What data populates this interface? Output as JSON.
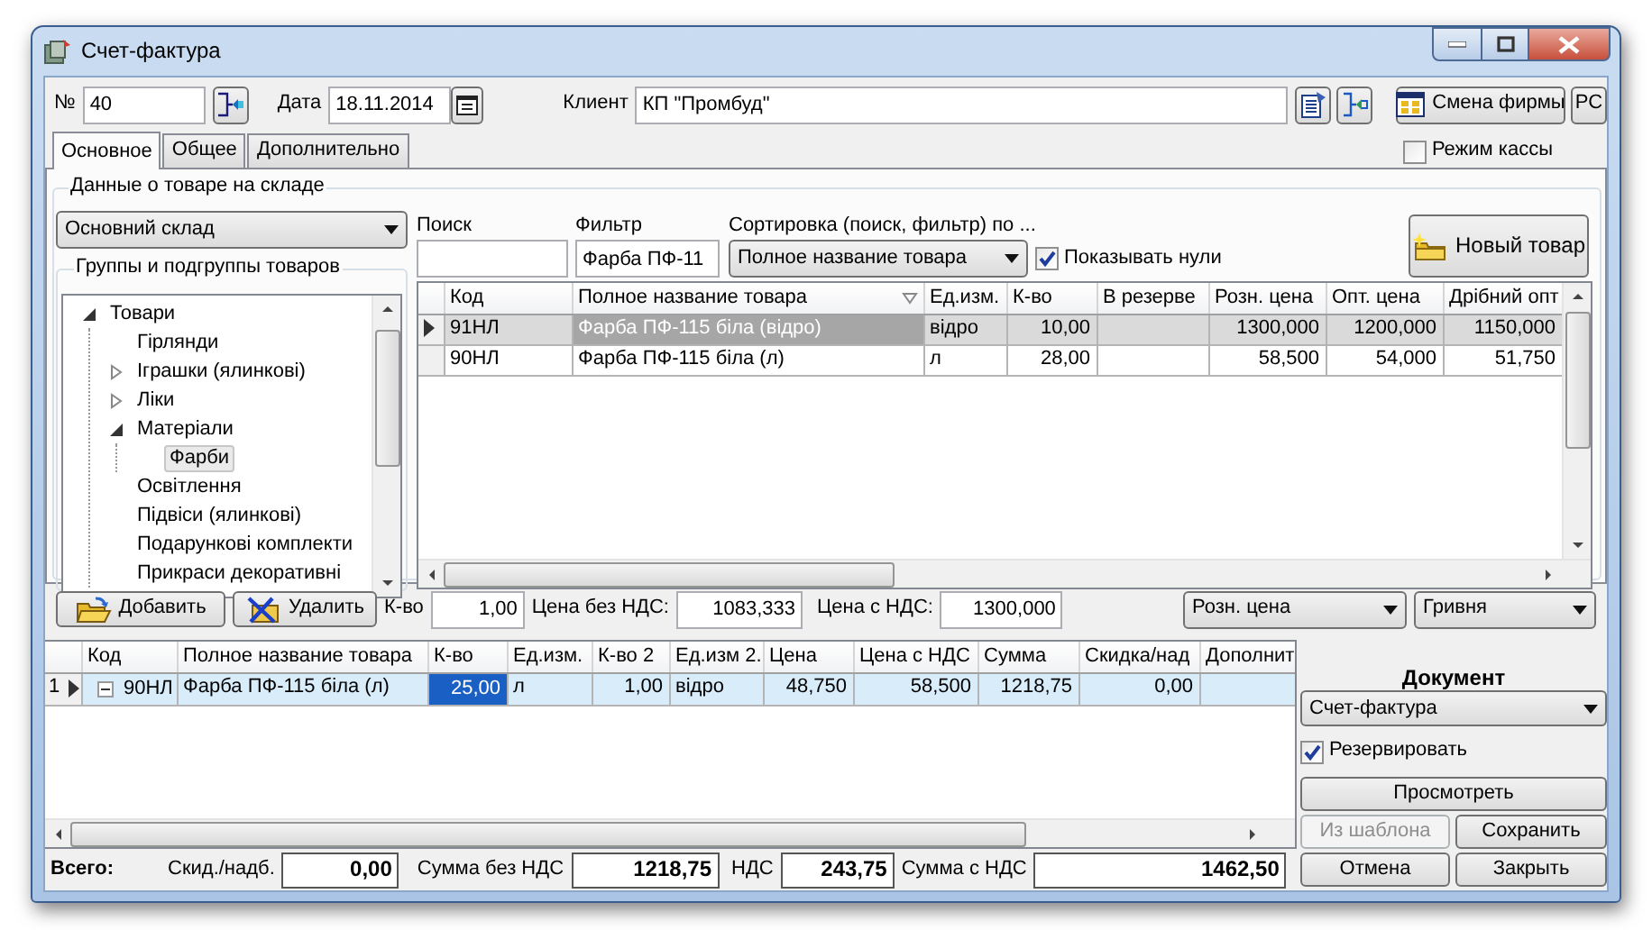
{
  "window": {
    "title": "Счет-фактура"
  },
  "header": {
    "number_label": "№",
    "number": "40",
    "date_label": "Дата",
    "date": "18.11.2014",
    "client_label": "Клиент",
    "client": "КП \"Промбуд\"",
    "firm_button": "Смена фирмы",
    "rs_button": "РС"
  },
  "tabs": [
    {
      "label": "Основное",
      "selected": true
    },
    {
      "label": "Общее",
      "selected": false
    },
    {
      "label": "Дополнительно",
      "selected": false
    }
  ],
  "cash_mode": {
    "label": "Режим кассы",
    "checked": false
  },
  "stock": {
    "legend": "Данные о товаре на складе",
    "warehouse": "Основний склад",
    "groups_legend": "Группы и подгруппы товаров",
    "search_label": "Поиск",
    "filter_label": "Фильтр",
    "filter": "Фарба ПФ-11",
    "sort_label": "Сортировка (поиск, фильтр) по ...",
    "sort": "Полное название товара",
    "show_zeros": {
      "label": "Показывать нули",
      "checked": true
    },
    "new_button": "Новый товар"
  },
  "tree": [
    {
      "label": "Товари",
      "expanded": true,
      "selected": false,
      "children": [
        {
          "label": "Гірлянди",
          "selected": false
        },
        {
          "label": "Іграшки (ялинкові)",
          "expanded": false,
          "selected": false
        },
        {
          "label": "Ліки",
          "expanded": false,
          "selected": false
        },
        {
          "label": "Матеріали",
          "expanded": true,
          "selected": false,
          "children": [
            {
              "label": "Фарби",
              "selected": true
            }
          ]
        },
        {
          "label": "Освітлення",
          "selected": false
        },
        {
          "label": "Підвіси (ялинкові)",
          "selected": false
        },
        {
          "label": "Подарункові комплекти",
          "selected": false
        },
        {
          "label": "Прикраси декоративні",
          "selected": false
        }
      ]
    }
  ],
  "goods_table": {
    "columns": [
      {
        "label": "Код",
        "sorted": false
      },
      {
        "label": "Полное название товара",
        "sorted": true
      },
      {
        "label": "Ед.изм.",
        "sorted": false
      },
      {
        "label": "К-во",
        "sorted": false
      },
      {
        "label": "В резерве",
        "sorted": false
      },
      {
        "label": "Розн. цена",
        "sorted": false
      },
      {
        "label": "Опт. цена",
        "sorted": false
      },
      {
        "label": "Дрібний опт",
        "sorted": false
      }
    ],
    "rows": [
      {
        "selected": true,
        "cells": [
          {
            "text": "91НЛ",
            "focused": false
          },
          {
            "text": "Фарба ПФ-115 біла (відро)",
            "focused": true
          },
          {
            "text": "відро",
            "focused": false
          },
          {
            "text": "10,00",
            "focused": false
          },
          {
            "focused": false
          },
          {
            "text": "1300,000",
            "focused": false
          },
          {
            "text": "1200,000",
            "focused": false
          },
          {
            "text": "1150,000",
            "focused": false
          }
        ]
      },
      {
        "selected": false,
        "cells": [
          {
            "text": "90НЛ",
            "focused": false
          },
          {
            "text": "Фарба ПФ-115 біла (л)",
            "focused": false
          },
          {
            "text": "л",
            "focused": false
          },
          {
            "text": "28,00",
            "focused": false
          },
          {
            "focused": false
          },
          {
            "text": "58,500",
            "focused": false
          },
          {
            "text": "54,000",
            "focused": false
          },
          {
            "text": "51,750",
            "focused": false
          }
        ]
      }
    ]
  },
  "line_controls": {
    "add": "Добавить",
    "remove": "Удалить",
    "qty_label": "К-во",
    "qty": "1,00",
    "price_label": "Цена без НДС:",
    "price": "1083,333",
    "price_vat_label": "Цена с НДС:",
    "price_vat": "1300,000",
    "price_type": "Розн. цена",
    "currency": "Гривня"
  },
  "invoice_table": {
    "columns": [
      "Код",
      "Полное название товара",
      "К-во",
      "Ед.изм.",
      "К-во 2",
      "Ед.изм 2.",
      "Цена",
      "Цена с НДС",
      "Сумма",
      "Скидка/над",
      "Дополнит"
    ],
    "rows": [
      {
        "number": "1",
        "selected": true,
        "expanded": true,
        "cells": [
          {
            "text": "90НЛ",
            "focused": false
          },
          {
            "text": "Фарба ПФ-115 біла (л)",
            "focused": false
          },
          {
            "text": "25,00",
            "focused": true
          },
          {
            "text": "л",
            "focused": false
          },
          {
            "text": "1,00",
            "focused": false
          },
          {
            "text": "відро",
            "focused": false
          },
          {
            "text": "48,750",
            "focused": false
          },
          {
            "text": "58,500",
            "focused": false
          },
          {
            "text": "1218,75",
            "focused": false
          },
          {
            "text": "0,00",
            "focused": false
          },
          {
            "focused": false
          }
        ]
      }
    ]
  },
  "document": {
    "title": "Документ",
    "type": "Счет-фактура",
    "reserve": {
      "label": "Резервировать",
      "checked": true
    },
    "buttons": [
      {
        "label": "Просмотреть",
        "disabled": false
      },
      {
        "label": "Из шаблона",
        "disabled": true
      },
      {
        "label": "Сохранить",
        "disabled": false
      },
      {
        "label": "Отмена",
        "disabled": false
      },
      {
        "label": "Закрыть",
        "disabled": false
      }
    ]
  },
  "totals": {
    "title": "Всего:",
    "items": [
      {
        "label": "Скид./надб.",
        "value": "0,00"
      },
      {
        "label": "Сумма без НДС",
        "value": "1218,75"
      },
      {
        "label": "НДС",
        "value": "243,75"
      },
      {
        "label": "Сумма с НДС",
        "value": "1462,50"
      }
    ]
  }
}
